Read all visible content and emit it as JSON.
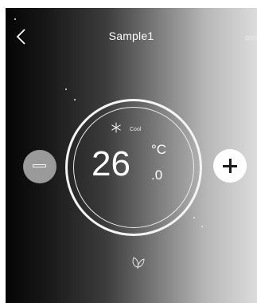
{
  "header": {
    "title": "Sample1",
    "back_icon": "chevron-left-icon",
    "more_icon": "more-options-icon",
    "more_glyph": "ooo"
  },
  "dial": {
    "mode_icon": "snowflake-icon",
    "mode_label": "Cool",
    "temperature": "26",
    "unit": "°C",
    "decimal": ".0"
  },
  "controls": {
    "decrease_icon": "minus-icon",
    "increase_icon": "plus-icon",
    "eco_icon": "leaf-icon"
  },
  "colors": {
    "gradient_start": "#050505",
    "gradient_end": "#dcdcdc",
    "dial_ring": "#f4f4f4",
    "minus_button": "#9a9a9a",
    "plus_button": "#ffffff"
  }
}
